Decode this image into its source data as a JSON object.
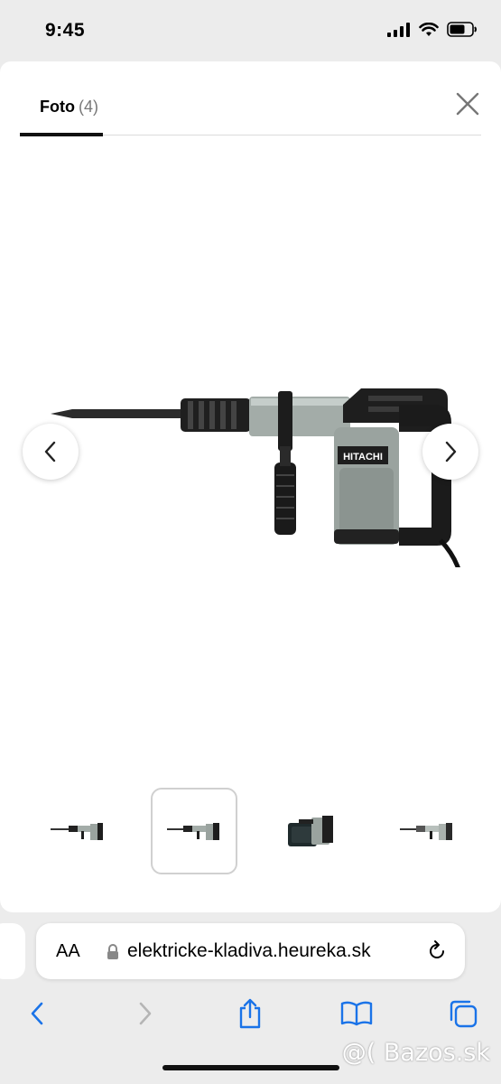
{
  "status_bar": {
    "time": "9:45"
  },
  "gallery": {
    "tab_label": "Foto",
    "tab_count": "(4)",
    "brand_on_tool": "HITACHI",
    "thumbnail_count": 4,
    "active_thumbnail": 2
  },
  "browser": {
    "aa_label": "AA",
    "url": "elektricke-kladiva.heureka.sk"
  },
  "watermark": "@( Bazos.sk",
  "colors": {
    "accent": "#1a73e8",
    "tool_body": "#9fa8a4",
    "tool_dark": "#1f1f1f"
  }
}
